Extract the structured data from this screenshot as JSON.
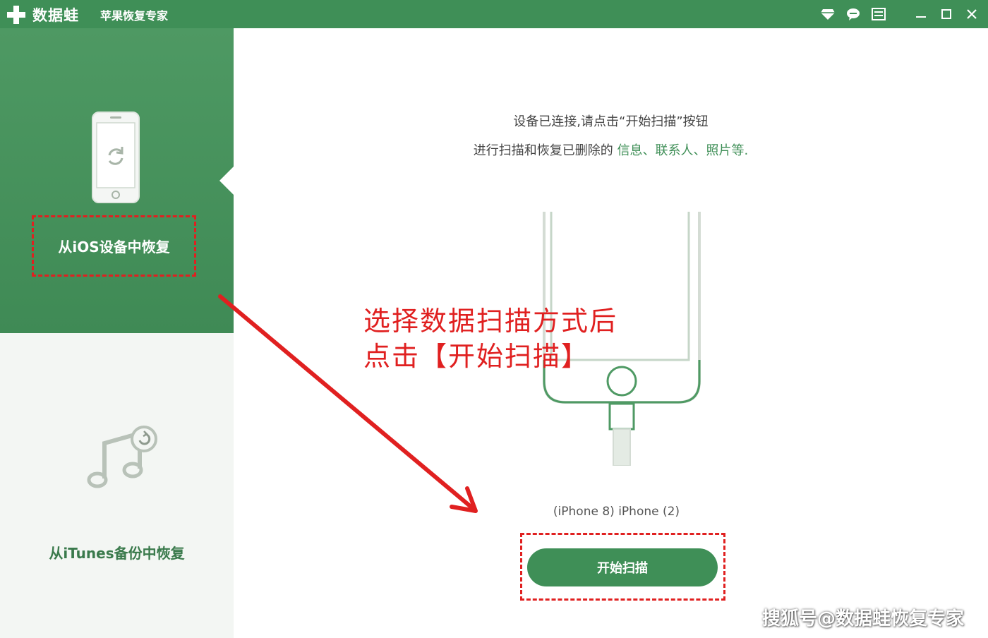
{
  "titlebar": {
    "app_name": "数据蛙",
    "app_subtitle": "苹果恢复专家"
  },
  "sidebar": {
    "items": [
      {
        "label": "从iOS设备中恢复",
        "active": true,
        "icon": "phone-restore-icon"
      },
      {
        "label": "从iTunes备份中恢复",
        "active": false,
        "icon": "music-restore-icon"
      }
    ]
  },
  "main": {
    "instruction_line1": "设备已连接,请点击“开始扫描”按钮",
    "instruction_line2_prefix": "进行扫描和恢复已删除的",
    "instruction_line2_highlight": "信息、联系人、照片等.",
    "device_name": "(iPhone 8) iPhone (2)",
    "scan_button_label": "开始扫描"
  },
  "annotation": {
    "line1": "选择数据扫描方式后",
    "line2": "点击【开始扫描】"
  },
  "watermark": "搜狐号@数据蛙恢复专家",
  "colors": {
    "brand_green": "#3f8f57",
    "annotation_red": "#e02020"
  }
}
